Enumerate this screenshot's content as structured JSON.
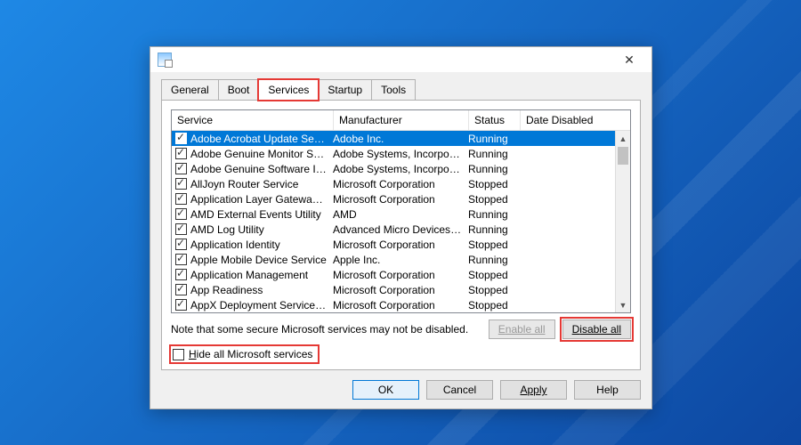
{
  "tabs": [
    "General",
    "Boot",
    "Services",
    "Startup",
    "Tools"
  ],
  "active_tab_index": 2,
  "columns": {
    "service": "Service",
    "manufacturer": "Manufacturer",
    "status": "Status",
    "date_disabled": "Date Disabled"
  },
  "rows": [
    {
      "checked": true,
      "selected": true,
      "service": "Adobe Acrobat Update Service",
      "manufacturer": "Adobe Inc.",
      "status": "Running",
      "date_disabled": ""
    },
    {
      "checked": true,
      "selected": false,
      "service": "Adobe Genuine Monitor Service",
      "manufacturer": "Adobe Systems, Incorpora...",
      "status": "Running",
      "date_disabled": ""
    },
    {
      "checked": true,
      "selected": false,
      "service": "Adobe Genuine Software Integri...",
      "manufacturer": "Adobe Systems, Incorpora...",
      "status": "Running",
      "date_disabled": ""
    },
    {
      "checked": true,
      "selected": false,
      "service": "AllJoyn Router Service",
      "manufacturer": "Microsoft Corporation",
      "status": "Stopped",
      "date_disabled": ""
    },
    {
      "checked": true,
      "selected": false,
      "service": "Application Layer Gateway Service",
      "manufacturer": "Microsoft Corporation",
      "status": "Stopped",
      "date_disabled": ""
    },
    {
      "checked": true,
      "selected": false,
      "service": "AMD External Events Utility",
      "manufacturer": "AMD",
      "status": "Running",
      "date_disabled": ""
    },
    {
      "checked": true,
      "selected": false,
      "service": "AMD Log Utility",
      "manufacturer": "Advanced Micro Devices, I...",
      "status": "Running",
      "date_disabled": ""
    },
    {
      "checked": true,
      "selected": false,
      "service": "Application Identity",
      "manufacturer": "Microsoft Corporation",
      "status": "Stopped",
      "date_disabled": ""
    },
    {
      "checked": true,
      "selected": false,
      "service": "Apple Mobile Device Service",
      "manufacturer": "Apple Inc.",
      "status": "Running",
      "date_disabled": ""
    },
    {
      "checked": true,
      "selected": false,
      "service": "Application Management",
      "manufacturer": "Microsoft Corporation",
      "status": "Stopped",
      "date_disabled": ""
    },
    {
      "checked": true,
      "selected": false,
      "service": "App Readiness",
      "manufacturer": "Microsoft Corporation",
      "status": "Stopped",
      "date_disabled": ""
    },
    {
      "checked": true,
      "selected": false,
      "service": "AppX Deployment Service (AppX...",
      "manufacturer": "Microsoft Corporation",
      "status": "Stopped",
      "date_disabled": ""
    }
  ],
  "note": "Note that some secure Microsoft services may not be disabled.",
  "buttons": {
    "enable_all": "Enable all",
    "disable_all": "Disable all",
    "ok": "OK",
    "cancel": "Cancel",
    "apply": "Apply",
    "help": "Help"
  },
  "hide_checkbox": {
    "checked": false,
    "label_pre": "H",
    "label_post": "ide all Microsoft services"
  }
}
